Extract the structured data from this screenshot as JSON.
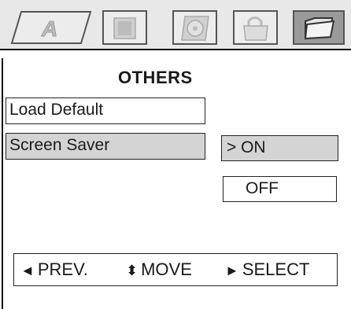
{
  "tabs": {
    "general_icon": "general-A-icon",
    "picture_icon": "picture-icon",
    "audio_icon": "audio-disc-icon",
    "lock_icon": "lock-icon",
    "others_icon": "folder-icon",
    "selected": "others"
  },
  "menu": {
    "title": "OTHERS",
    "items": [
      {
        "label": "Load Default",
        "highlighted": false
      },
      {
        "label": "Screen Saver",
        "highlighted": true
      }
    ]
  },
  "options": {
    "on_label": "> ON",
    "off_label": "OFF",
    "selected": "ON"
  },
  "hints": {
    "prev_glyph": "◄",
    "prev_label": "PREV.",
    "move_glyph": "⬍",
    "move_label": "MOVE",
    "select_glyph": "►",
    "select_label": "SELECT"
  },
  "colors": {
    "highlight": "#d4d4d4",
    "topbar": "#e8e8e8",
    "selected_tab": "#9a9a9a"
  }
}
